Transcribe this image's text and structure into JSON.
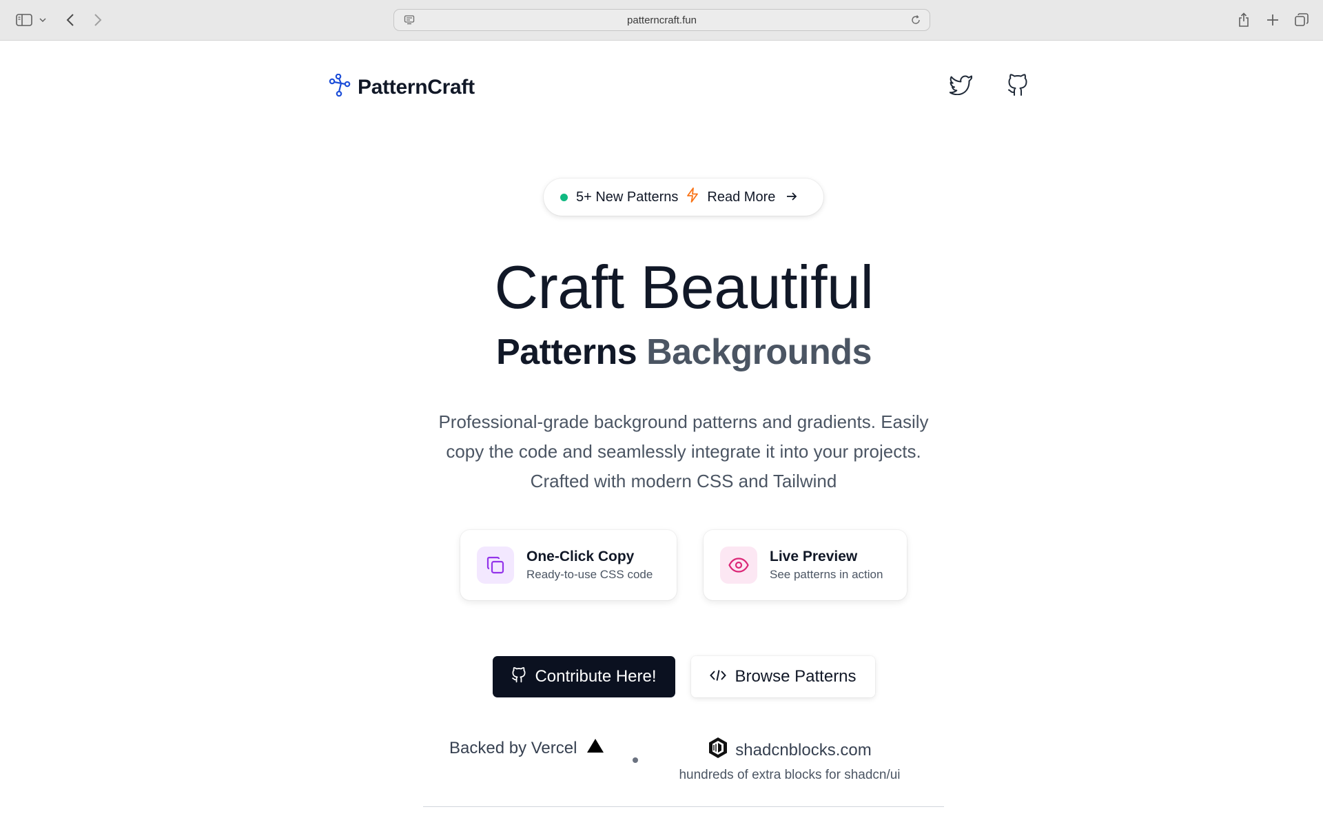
{
  "browser": {
    "url": "patterncraft.fun"
  },
  "header": {
    "brand": "PatternCraft",
    "icons": [
      "twitter-icon",
      "github-icon"
    ]
  },
  "badge": {
    "count_label": "5+ New Patterns",
    "link_label": "Read More"
  },
  "hero": {
    "title": "Craft Beautiful",
    "subtitle_a": "Patterns",
    "subtitle_b": "Backgrounds",
    "description_lines": [
      "Professional-grade background patterns and gradients. Easily",
      "copy the code and seamlessly integrate it into your projects.",
      "Crafted with modern CSS and Tailwind"
    ]
  },
  "features": [
    {
      "title": "One-Click Copy",
      "subtitle": "Ready-to-use CSS code",
      "icon": "copy-icon"
    },
    {
      "title": "Live Preview",
      "subtitle": "See patterns in action",
      "icon": "eye-icon"
    }
  ],
  "actions": {
    "contribute_label": "Contribute Here!",
    "browse_label": "Browse Patterns"
  },
  "sponsors": {
    "backed_label": "Backed by Vercel",
    "shad_name": "shadcnblocks.com",
    "shad_tagline": "hundreds of extra blocks for shadcn/ui"
  },
  "colors": {
    "accent_green": "#10b981",
    "accent_orange": "#f97316",
    "copy_purple": "#9333ea",
    "eye_pink": "#db2777",
    "logo_blue": "#1d4ed8",
    "dark_button": "#0b1120"
  }
}
